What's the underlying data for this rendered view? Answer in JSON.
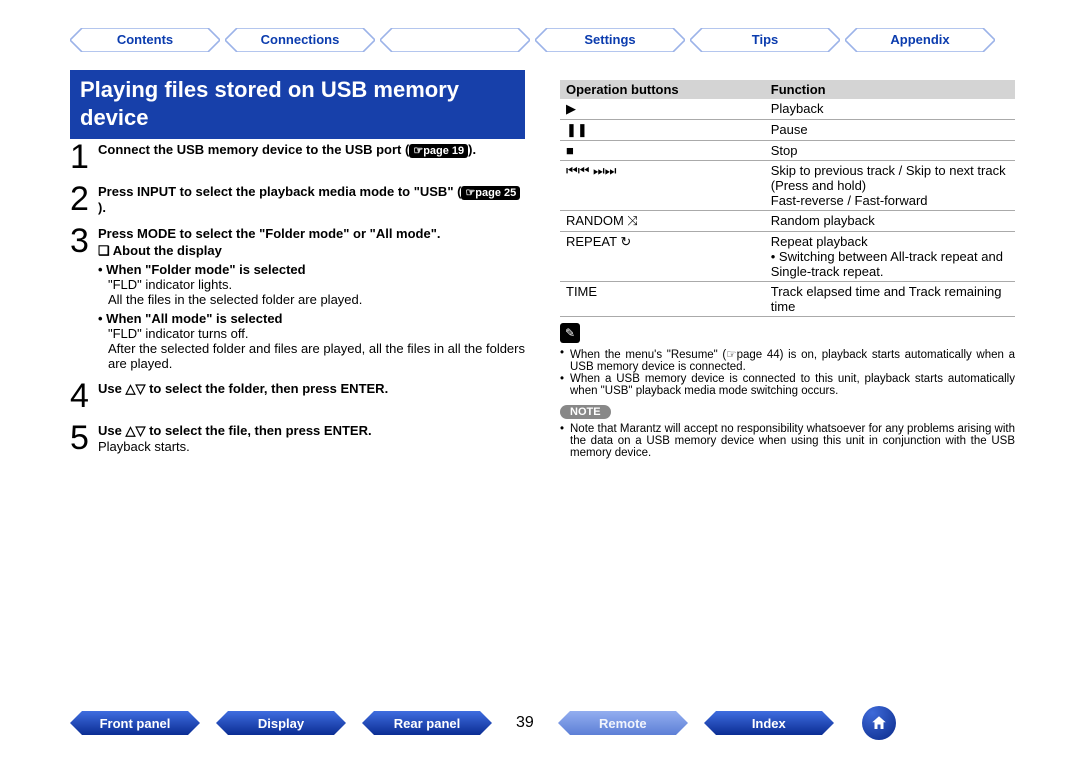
{
  "topnav": {
    "contents": "Contents",
    "connections": "Connections",
    "playback": "",
    "settings": "Settings",
    "tips": "Tips",
    "appendix": "Appendix"
  },
  "heading": "Playing files stored on USB memory device",
  "steps": {
    "s1": {
      "num": "1",
      "text_a": "Connect the USB memory device to the USB port (",
      "link": "☞page 19",
      "text_b": ")."
    },
    "s2": {
      "num": "2",
      "text_a": "Press INPUT to select the playback media mode to \"USB\" (",
      "link": "☞page 25",
      "text_b": ")."
    },
    "s3": {
      "num": "3",
      "text": "Press MODE to select the \"Folder mode\" or \"All mode\".",
      "about_title": "About the display",
      "folder_title": "When \"Folder mode\" is selected",
      "folder_l1": "\"FLD\" indicator lights.",
      "folder_l2": "All the files in the selected folder are played.",
      "all_title": "When \"All mode\" is selected",
      "all_l1": "\"FLD\" indicator turns off.",
      "all_l2": "After the selected folder and files are played, all the files in all the folders are played."
    },
    "s4": {
      "num": "4",
      "text": "Use △▽ to select the folder, then press ENTER."
    },
    "s5": {
      "num": "5",
      "text": "Use △▽ to select the file, then press ENTER.",
      "sub": "Playback starts."
    }
  },
  "table": {
    "h1": "Operation buttons",
    "h2": "Function",
    "rows": [
      {
        "btn": "▶",
        "fn": "Playback"
      },
      {
        "btn": "❚❚",
        "fn": "Pause"
      },
      {
        "btn": "■",
        "fn": "Stop"
      },
      {
        "btn": "⏮⏮ ⏭⏭",
        "fn": "Skip to previous track / Skip to next track\n(Press and hold)\nFast-reverse / Fast-forward"
      },
      {
        "btn": "RANDOM ⤨",
        "fn": "Random playback"
      },
      {
        "btn": "REPEAT ↻",
        "fn": "Repeat playback\n• Switching between All-track repeat and Single-track repeat."
      },
      {
        "btn": "TIME",
        "fn": "Track elapsed time and Track remaining time"
      }
    ]
  },
  "pencil_notes": [
    "When the menu's \"Resume\" (☞page 44) is on, playback starts automatically when a USB memory device is connected.",
    "When a USB memory device is connected to this unit, playback starts automatically when \"USB\" playback media mode switching occurs."
  ],
  "note_label": "NOTE",
  "note_items": [
    "Note that Marantz will accept no responsibility whatsoever for any problems arising with the data on a USB memory device when using this unit in conjunction with the USB memory device."
  ],
  "bottomnav": {
    "front": "Front panel",
    "display": "Display",
    "rear": "Rear panel",
    "page": "39",
    "remote": "Remote",
    "index": "Index"
  }
}
